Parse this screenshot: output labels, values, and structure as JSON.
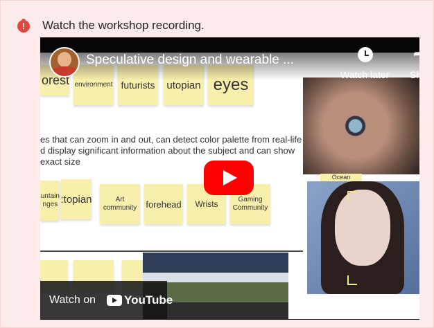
{
  "message": {
    "text": "Watch the workshop recording.",
    "icon": "alert-icon"
  },
  "video": {
    "title": "Speculative design and wearable ...",
    "watch_later": "Watch later",
    "share": "Share",
    "watch_on": "Watch on",
    "platform": "YouTube",
    "accent": "#ff0000"
  },
  "board": {
    "top_row": [
      "orest",
      "environment",
      "futurists",
      "utopian",
      "eyes"
    ],
    "description": [
      "es that can zoom in and out, can detect color palette from real-life",
      "d display significant information about the subject and can show exact size"
    ],
    "bottom_row": [
      "untain\nnges",
      ":topian",
      "Art\ncommunity",
      "forehead",
      "Wrists",
      "Gaming\nCommunity"
    ],
    "label_ocean": "Ocean"
  }
}
